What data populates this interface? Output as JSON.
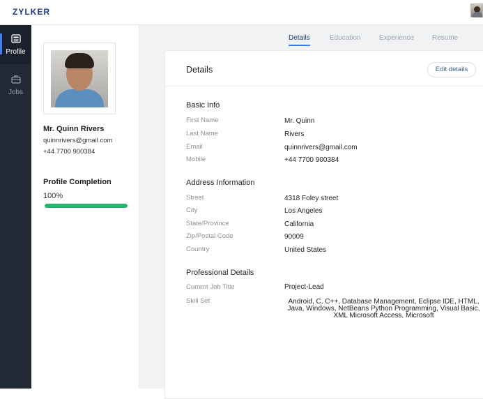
{
  "brand": "ZYLKER",
  "sidebar": {
    "items": [
      {
        "label": "Profile",
        "icon": "profile-card-icon",
        "active": true
      },
      {
        "label": "Jobs",
        "icon": "briefcase-icon",
        "active": false
      }
    ]
  },
  "profile": {
    "name": "Mr. Quinn Rivers",
    "email": "quinnrivers@gmail.com",
    "phone": "+44 7700 900384",
    "completion_title": "Profile Completion",
    "completion_value": "100%",
    "completion_fraction": 1.0
  },
  "tabs": [
    {
      "label": "Details",
      "active": true
    },
    {
      "label": "Education",
      "active": false
    },
    {
      "label": "Experience",
      "active": false
    },
    {
      "label": "Resume",
      "active": false
    }
  ],
  "details": {
    "title": "Details",
    "edit_label": "Edit details",
    "basic_info": {
      "title": "Basic Info",
      "fields": [
        {
          "label": "First Name",
          "value": "Mr.   Quinn"
        },
        {
          "label": "Last Name",
          "value": "Rivers"
        },
        {
          "label": "Email",
          "value": "quinnrivers@gmail.com"
        },
        {
          "label": "Mobile",
          "value": "+44 7700 900384"
        }
      ]
    },
    "address": {
      "title": "Address Information",
      "fields": [
        {
          "label": "Street",
          "value": "4318 Foley street"
        },
        {
          "label": "City",
          "value": "Los Angeles"
        },
        {
          "label": "State/Province",
          "value": "California"
        },
        {
          "label": "Zip/Postal Code",
          "value": "90009"
        },
        {
          "label": "Country",
          "value": "United States"
        }
      ]
    },
    "professional": {
      "title": "Professional Details",
      "fields": [
        {
          "label": "Current Job Title",
          "value": "Project-Lead"
        },
        {
          "label": "Skill Set",
          "value": "Android, C, C++, Database Management, Eclipse IDE, HTML, Java, Windows, NetBeans Python Programming, Visual Basic, XML Microsoft Access, Microsoft"
        }
      ]
    }
  },
  "colors": {
    "sidebar_bg": "#232a36",
    "accent": "#3f7ee8",
    "progress": "#27b56b",
    "brand": "#1f3b82"
  }
}
